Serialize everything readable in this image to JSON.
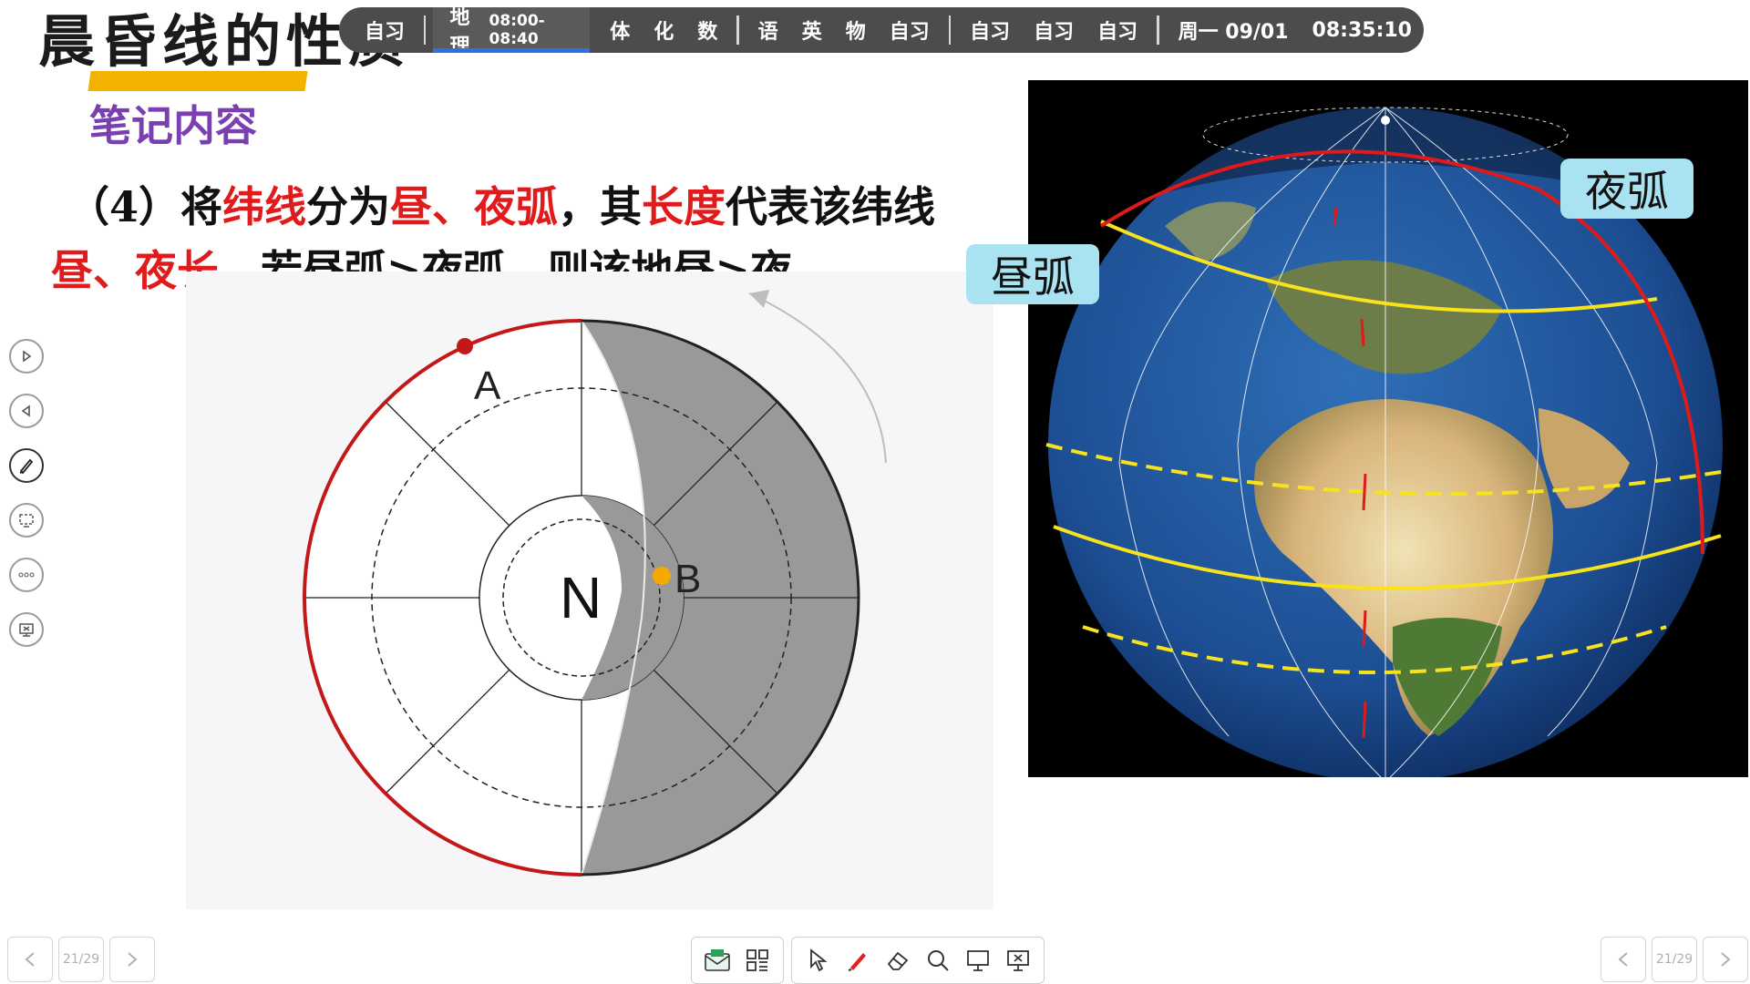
{
  "slide": {
    "title": "晨昏线的性质",
    "subtitle": "笔记内容",
    "line1": [
      {
        "text": "（4）将",
        "color": "black"
      },
      {
        "text": "纬线",
        "color": "red"
      },
      {
        "text": "分为",
        "color": "black"
      },
      {
        "text": "昼、夜弧",
        "color": "red"
      },
      {
        "text": "，其",
        "color": "black"
      },
      {
        "text": "长度",
        "color": "red"
      },
      {
        "text": "代表该纬线",
        "color": "black"
      }
    ],
    "line2": [
      {
        "text": "昼、夜长，",
        "color": "red"
      },
      {
        "text": "若昼弧>夜弧，则该地昼>夜",
        "color": "black"
      }
    ]
  },
  "schedule": {
    "items_before": [
      "自习"
    ],
    "current": {
      "subject": "地理",
      "time": "08:00-08:40"
    },
    "group2": [
      "体",
      "化",
      "数"
    ],
    "group3": [
      "语",
      "英",
      "物",
      "自习"
    ],
    "group4": [
      "自习",
      "自习",
      "自习"
    ],
    "date": "周一 09/01",
    "clock": "08:35:10"
  },
  "polar_figure": {
    "center_label": "N",
    "point_a": "A",
    "point_b": "B"
  },
  "globe_figure": {
    "day_arc_label": "昼弧",
    "night_arc_label": "夜弧"
  },
  "sidebar": {
    "tools": [
      "play-next-icon",
      "play-prev-icon",
      "pen-icon",
      "screen-capture-icon",
      "more-icon",
      "exit-presentation-icon"
    ]
  },
  "pager": {
    "left_label": "21/29",
    "right_label": "21/29"
  },
  "bottom_toolbar": {
    "tools": [
      "envelope-icon",
      "apps-grid-icon",
      "pointer-icon",
      "pen-icon",
      "eraser-icon",
      "zoom-icon",
      "whiteboard-icon",
      "end-show-icon"
    ]
  },
  "colors": {
    "accent_red": "#e11b1b",
    "title_bar": "#f2b300",
    "subtitle_purple": "#7a3fb0",
    "schedule_bg": "#4c4c4c",
    "callout_bg": "#a9e2f1"
  }
}
